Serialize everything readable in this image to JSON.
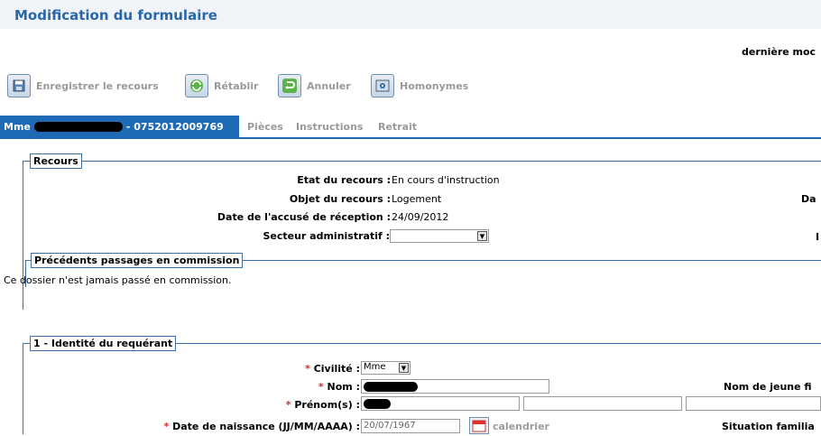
{
  "header": {
    "title": "Modification du formulaire",
    "last_modified": "dernière moc"
  },
  "toolbar": {
    "save": "Enregistrer le recours",
    "reset": "Rétablir",
    "cancel": "Annuler",
    "homonyms": "Homonymes"
  },
  "tabs": {
    "active_prefix": "Mme",
    "active_suffix": "- 0752012009769",
    "items": [
      "Pièces",
      "Instructions",
      "Retrait"
    ]
  },
  "recours": {
    "legend": "Recours",
    "etat_label": "Etat du recours :",
    "etat_value": "En cours d'instruction",
    "objet_label": "Objet du recours :",
    "objet_value": "Logement",
    "date_label": "Date de l'accusé de réception :",
    "date_value": "24/09/2012",
    "secteur_label": "Secteur administratif :",
    "secteur_value": "",
    "right_label_1": "Da",
    "right_label_2": "I"
  },
  "precedents": {
    "legend": "Précédents passages en commission",
    "text": "Ce dossier n'est jamais passé en commission."
  },
  "identite": {
    "legend": "1 - Identité du requérant",
    "req_mark": "*",
    "civilite_label": "Civilité :",
    "civilite_value": "Mme",
    "nom_label": "Nom :",
    "prenom_label": "Prénom(s) :",
    "naissance_label": "Date de naissance (JJ/MM/AAAA) :",
    "naissance_value": "20/07/1967",
    "calendrier": "calendrier",
    "jeune_fille_label": "Nom de jeune fi",
    "situation_label": "Situation familia"
  }
}
